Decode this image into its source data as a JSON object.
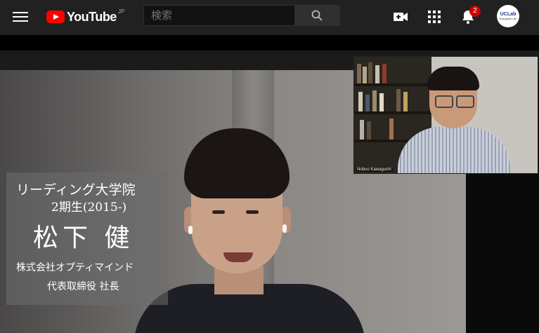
{
  "header": {
    "logo_text": "YouTube",
    "region": "JP",
    "search_placeholder": "検索",
    "notification_count": "2",
    "avatar_line1": "UCLab",
    "avatar_line2": "Kawaguchi Lab",
    "icons": [
      "menu-icon",
      "search-icon",
      "create-video-icon",
      "apps-grid-icon",
      "bell-icon"
    ]
  },
  "video": {
    "caption": {
      "school": "リーディング大学院",
      "term": "2期生(2015-)",
      "name": "松下 健",
      "company": "株式会社オプティマインド",
      "role": "代表取締役 社長"
    },
    "pip_label": "Nobuo Kawaguchi"
  },
  "colors": {
    "header_bg": "#212121",
    "brand_red": "#ff0000",
    "badge_red": "#cc0000"
  }
}
